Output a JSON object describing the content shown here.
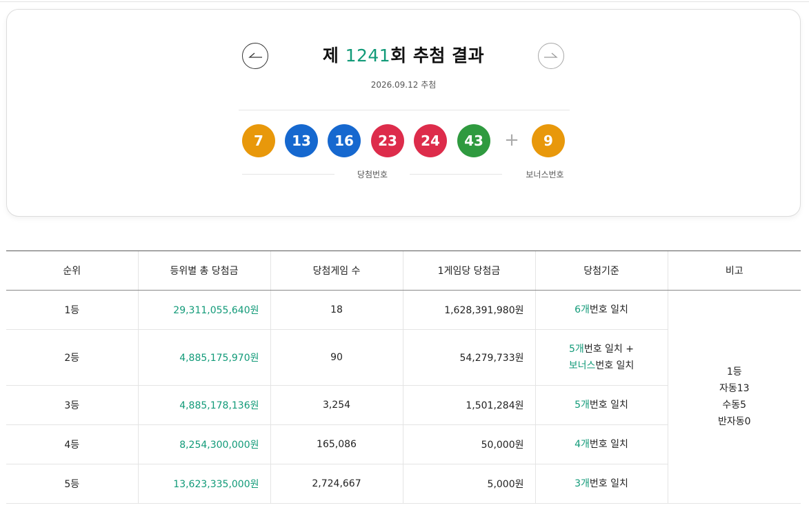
{
  "draw": {
    "title_prefix": "제 ",
    "round": "1241",
    "title_suffix": "회 추첨 결과",
    "date": "2026.09.12 추첨",
    "winning_label": "당첨번호",
    "bonus_label": "보너스번호",
    "plus_sign": "+",
    "numbers": [
      "7",
      "13",
      "16",
      "23",
      "24",
      "43"
    ],
    "bonus": "9",
    "ball_colors": {
      "orange": "#e8980b",
      "blue": "#1668cf",
      "red": "#dd2c4b",
      "green": "#2f9a3f"
    },
    "nav": {
      "prev_icon": "arrow-left-icon",
      "next_icon": "arrow-right-icon"
    }
  },
  "table": {
    "headers": [
      "순위",
      "등위별 총 당첨금",
      "당첨게임 수",
      "1게임당 당첨금",
      "당첨기준",
      "비고"
    ],
    "rows": [
      {
        "rank": "1등",
        "total": "29,311,055,640원",
        "games": "18",
        "per_game": "1,628,391,980원",
        "crit_count": "6개",
        "crit_text": "번호 일치"
      },
      {
        "rank": "2등",
        "total": "4,885,175,970원",
        "games": "90",
        "per_game": "54,279,733원",
        "crit_count": "5개",
        "crit_text": "번호 일치 +",
        "crit_bonus": "보너스",
        "crit_bonus_text": "번호 일치"
      },
      {
        "rank": "3등",
        "total": "4,885,178,136원",
        "games": "3,254",
        "per_game": "1,501,284원",
        "crit_count": "5개",
        "crit_text": "번호 일치"
      },
      {
        "rank": "4등",
        "total": "8,254,300,000원",
        "games": "165,086",
        "per_game": "50,000원",
        "crit_count": "4개",
        "crit_text": "번호 일치"
      },
      {
        "rank": "5등",
        "total": "13,623,335,000원",
        "games": "2,724,667",
        "per_game": "5,000원",
        "crit_count": "3개",
        "crit_text": "번호 일치"
      }
    ],
    "note": [
      "1등",
      "자동13",
      "수동5",
      "반자동0"
    ]
  },
  "accent_color": "#119a78"
}
